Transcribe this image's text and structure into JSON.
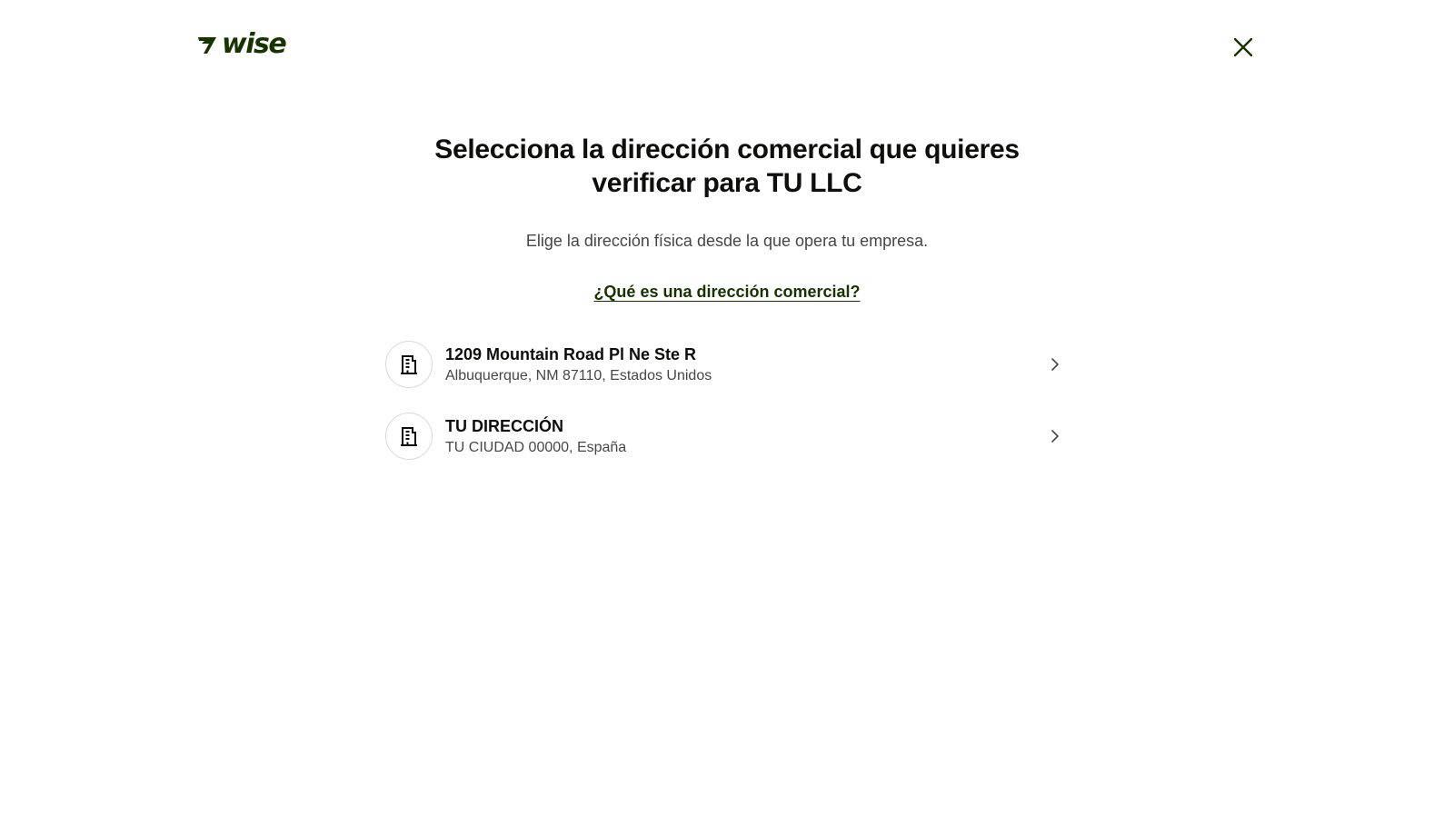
{
  "header": {
    "logo_text": "wise",
    "close_icon": "close-icon"
  },
  "main": {
    "title": "Selecciona la dirección comercial que quieres verificar para TU LLC",
    "subtitle": "Elige la dirección física desde la que opera tu empresa.",
    "help_link": "¿Qué es una dirección comercial?"
  },
  "addresses": [
    {
      "icon": "building-icon",
      "line1": "1209 Mountain Road Pl Ne Ste R",
      "line2": "Albuquerque, NM 87110, Estados Unidos"
    },
    {
      "icon": "building-icon",
      "line1": "TU DIRECCIÓN",
      "line2": "TU CIUDAD 00000, España"
    }
  ],
  "colors": {
    "brand": "#163300",
    "text_primary": "#0e0f0c",
    "text_secondary": "#454745",
    "border": "#d9dbd8"
  }
}
